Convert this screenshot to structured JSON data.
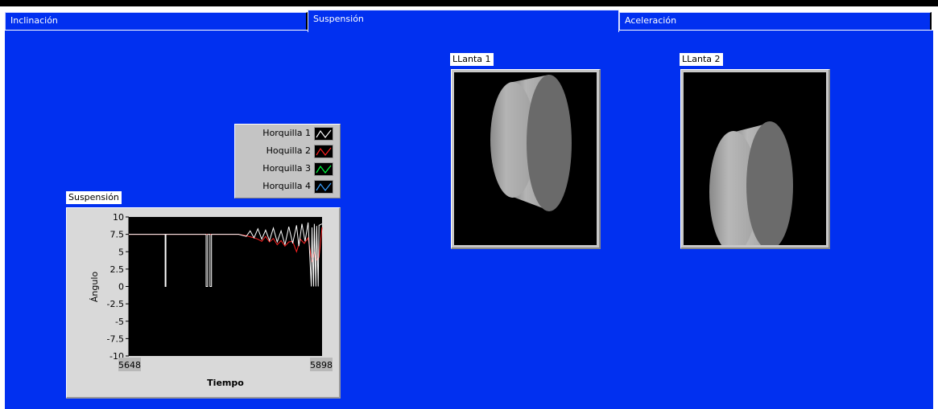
{
  "tabs": [
    {
      "label": "Inclinación",
      "active": false
    },
    {
      "label": "Suspensión",
      "active": true
    },
    {
      "label": "Aceleración",
      "active": false
    }
  ],
  "legend": {
    "items": [
      {
        "label": "Horquilla 1",
        "color": "#ffffff"
      },
      {
        "label": "Hoquilla 2",
        "color": "#ff2020"
      },
      {
        "label": "Horquilla 3",
        "color": "#00ff40"
      },
      {
        "label": "Horquilla 4",
        "color": "#3aa0ff"
      }
    ]
  },
  "chart": {
    "label": "Suspensión",
    "xlabel": "Tiempo",
    "ylabel": "Ángulo",
    "x_min_label": "5648",
    "x_max_label": "5898",
    "y_tick_labels": [
      "10",
      "7.5",
      "5",
      "2.5",
      "0",
      "-2.5",
      "-5",
      "-7.5",
      "-10"
    ]
  },
  "chart_data": {
    "type": "line",
    "title": "",
    "xlabel": "Tiempo",
    "ylabel": "Ángulo",
    "xlim": [
      5648,
      5898
    ],
    "ylim": [
      -10,
      10
    ],
    "grid": false,
    "series": [
      {
        "name": "Horquilla 1",
        "color": "#ffffff",
        "x": [
          5648,
          5695,
          5695,
          5696,
          5696,
          5748,
          5748,
          5750,
          5750,
          5753,
          5753,
          5755,
          5755,
          5790,
          5800,
          5805,
          5810,
          5815,
          5820,
          5825,
          5830,
          5835,
          5840,
          5845,
          5850,
          5855,
          5860,
          5865,
          5868,
          5872,
          5876,
          5880,
          5884,
          5885,
          5887,
          5888,
          5890,
          5891,
          5893,
          5894,
          5898
        ],
        "y": [
          7.5,
          7.5,
          0,
          0,
          7.5,
          7.5,
          0,
          0,
          7.5,
          7.5,
          0,
          0,
          7.5,
          7.5,
          7.2,
          8.0,
          7.0,
          8.3,
          6.8,
          8.1,
          6.6,
          8.4,
          6.4,
          8.0,
          6.0,
          8.6,
          6.2,
          8.8,
          5.8,
          9.0,
          6.5,
          9.2,
          0,
          8.5,
          0,
          9.0,
          0,
          8.7,
          0,
          8.8,
          9.0
        ]
      },
      {
        "name": "Hoquilla 2",
        "color": "#ff2020",
        "x": [
          5648,
          5790,
          5800,
          5810,
          5815,
          5820,
          5825,
          5830,
          5835,
          5840,
          5845,
          5850,
          5855,
          5860,
          5865,
          5870,
          5875,
          5880,
          5885,
          5888,
          5891,
          5894,
          5898
        ],
        "y": [
          7.5,
          7.5,
          7.3,
          7.0,
          6.8,
          6.5,
          7.2,
          6.4,
          6.9,
          6.0,
          6.6,
          5.8,
          6.4,
          6.5,
          5.0,
          6.8,
          6.2,
          7.0,
          3.5,
          5.0,
          3.8,
          4.2,
          8.5
        ]
      }
    ]
  },
  "wheel1": {
    "label": "LLanta 1"
  },
  "wheel2": {
    "label": "LLanta 2"
  }
}
